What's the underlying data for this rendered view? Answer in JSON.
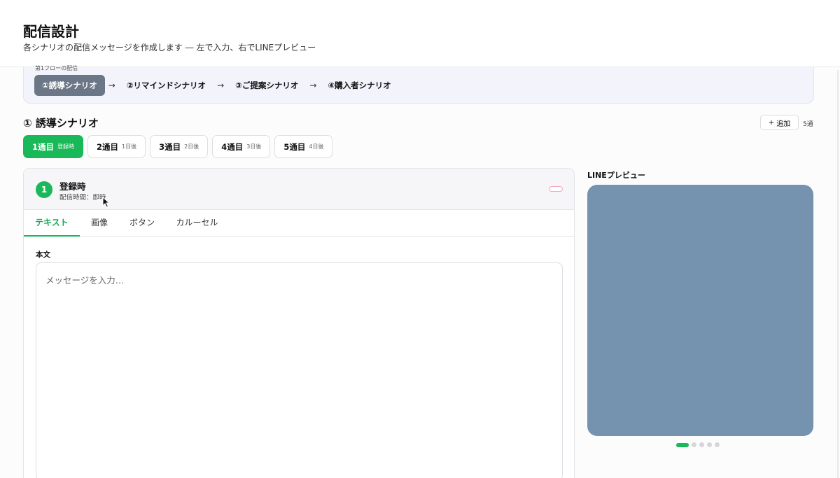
{
  "header": {
    "title": "配信設計",
    "subtitle": "各シナリオの配信メッセージを作成します ― 左で入力、右でLINEプレビュー"
  },
  "flow": {
    "caption": "第1フローの配信",
    "steps": [
      {
        "label": "①誘導シナリオ",
        "active": true
      },
      {
        "label": "②リマインドシナリオ",
        "active": false
      },
      {
        "label": "③ご提案シナリオ",
        "active": false
      },
      {
        "label": "④購入者シナリオ",
        "active": false
      }
    ],
    "arrow": "→"
  },
  "scenario": {
    "title": "① 誘導シナリオ",
    "add_icon": "+",
    "add_label": "追加",
    "week_count": "5通"
  },
  "weeks": [
    {
      "label": "1通目",
      "timing": "登録時",
      "active": true
    },
    {
      "label": "2通目",
      "timing": "1日後",
      "active": false
    },
    {
      "label": "3通目",
      "timing": "2日後",
      "active": false
    },
    {
      "label": "4通目",
      "timing": "3日後",
      "active": false
    },
    {
      "label": "5通目",
      "timing": "4日後",
      "active": false
    }
  ],
  "editor": {
    "step_number": "1",
    "title": "登録時",
    "send_time": "配信時間：即時",
    "tabs": [
      {
        "label": "テキスト",
        "active": true
      },
      {
        "label": "画像",
        "active": false
      },
      {
        "label": "ボタン",
        "active": false
      },
      {
        "label": "カルーセル",
        "active": false
      }
    ],
    "body_label": "本文",
    "message_placeholder": "メッセージを入力…",
    "message_value": ""
  },
  "preview": {
    "title": "LINEプレビュー",
    "background_color": "#7593ae",
    "dots": 5,
    "active_dot": 0
  },
  "colors": {
    "accent_green": "#19b858",
    "active_flow_step": "#6b7686"
  }
}
